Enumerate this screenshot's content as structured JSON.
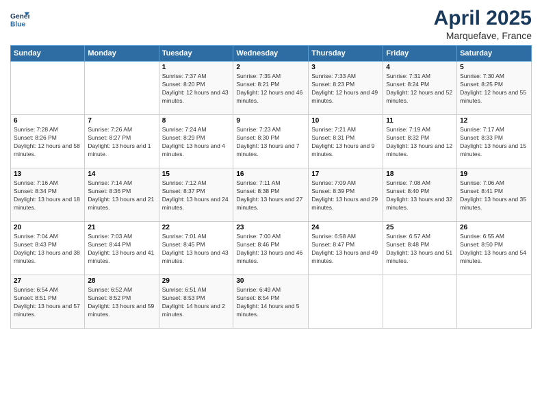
{
  "logo": {
    "line1": "General",
    "line2": "Blue"
  },
  "title": "April 2025",
  "subtitle": "Marquefave, France",
  "header": {
    "days": [
      "Sunday",
      "Monday",
      "Tuesday",
      "Wednesday",
      "Thursday",
      "Friday",
      "Saturday"
    ]
  },
  "weeks": [
    [
      {
        "day": "",
        "info": ""
      },
      {
        "day": "",
        "info": ""
      },
      {
        "day": "1",
        "info": "Sunrise: 7:37 AM\nSunset: 8:20 PM\nDaylight: 12 hours and 43 minutes."
      },
      {
        "day": "2",
        "info": "Sunrise: 7:35 AM\nSunset: 8:21 PM\nDaylight: 12 hours and 46 minutes."
      },
      {
        "day": "3",
        "info": "Sunrise: 7:33 AM\nSunset: 8:23 PM\nDaylight: 12 hours and 49 minutes."
      },
      {
        "day": "4",
        "info": "Sunrise: 7:31 AM\nSunset: 8:24 PM\nDaylight: 12 hours and 52 minutes."
      },
      {
        "day": "5",
        "info": "Sunrise: 7:30 AM\nSunset: 8:25 PM\nDaylight: 12 hours and 55 minutes."
      }
    ],
    [
      {
        "day": "6",
        "info": "Sunrise: 7:28 AM\nSunset: 8:26 PM\nDaylight: 12 hours and 58 minutes."
      },
      {
        "day": "7",
        "info": "Sunrise: 7:26 AM\nSunset: 8:27 PM\nDaylight: 13 hours and 1 minute."
      },
      {
        "day": "8",
        "info": "Sunrise: 7:24 AM\nSunset: 8:29 PM\nDaylight: 13 hours and 4 minutes."
      },
      {
        "day": "9",
        "info": "Sunrise: 7:23 AM\nSunset: 8:30 PM\nDaylight: 13 hours and 7 minutes."
      },
      {
        "day": "10",
        "info": "Sunrise: 7:21 AM\nSunset: 8:31 PM\nDaylight: 13 hours and 9 minutes."
      },
      {
        "day": "11",
        "info": "Sunrise: 7:19 AM\nSunset: 8:32 PM\nDaylight: 13 hours and 12 minutes."
      },
      {
        "day": "12",
        "info": "Sunrise: 7:17 AM\nSunset: 8:33 PM\nDaylight: 13 hours and 15 minutes."
      }
    ],
    [
      {
        "day": "13",
        "info": "Sunrise: 7:16 AM\nSunset: 8:34 PM\nDaylight: 13 hours and 18 minutes."
      },
      {
        "day": "14",
        "info": "Sunrise: 7:14 AM\nSunset: 8:36 PM\nDaylight: 13 hours and 21 minutes."
      },
      {
        "day": "15",
        "info": "Sunrise: 7:12 AM\nSunset: 8:37 PM\nDaylight: 13 hours and 24 minutes."
      },
      {
        "day": "16",
        "info": "Sunrise: 7:11 AM\nSunset: 8:38 PM\nDaylight: 13 hours and 27 minutes."
      },
      {
        "day": "17",
        "info": "Sunrise: 7:09 AM\nSunset: 8:39 PM\nDaylight: 13 hours and 29 minutes."
      },
      {
        "day": "18",
        "info": "Sunrise: 7:08 AM\nSunset: 8:40 PM\nDaylight: 13 hours and 32 minutes."
      },
      {
        "day": "19",
        "info": "Sunrise: 7:06 AM\nSunset: 8:41 PM\nDaylight: 13 hours and 35 minutes."
      }
    ],
    [
      {
        "day": "20",
        "info": "Sunrise: 7:04 AM\nSunset: 8:43 PM\nDaylight: 13 hours and 38 minutes."
      },
      {
        "day": "21",
        "info": "Sunrise: 7:03 AM\nSunset: 8:44 PM\nDaylight: 13 hours and 41 minutes."
      },
      {
        "day": "22",
        "info": "Sunrise: 7:01 AM\nSunset: 8:45 PM\nDaylight: 13 hours and 43 minutes."
      },
      {
        "day": "23",
        "info": "Sunrise: 7:00 AM\nSunset: 8:46 PM\nDaylight: 13 hours and 46 minutes."
      },
      {
        "day": "24",
        "info": "Sunrise: 6:58 AM\nSunset: 8:47 PM\nDaylight: 13 hours and 49 minutes."
      },
      {
        "day": "25",
        "info": "Sunrise: 6:57 AM\nSunset: 8:48 PM\nDaylight: 13 hours and 51 minutes."
      },
      {
        "day": "26",
        "info": "Sunrise: 6:55 AM\nSunset: 8:50 PM\nDaylight: 13 hours and 54 minutes."
      }
    ],
    [
      {
        "day": "27",
        "info": "Sunrise: 6:54 AM\nSunset: 8:51 PM\nDaylight: 13 hours and 57 minutes."
      },
      {
        "day": "28",
        "info": "Sunrise: 6:52 AM\nSunset: 8:52 PM\nDaylight: 13 hours and 59 minutes."
      },
      {
        "day": "29",
        "info": "Sunrise: 6:51 AM\nSunset: 8:53 PM\nDaylight: 14 hours and 2 minutes."
      },
      {
        "day": "30",
        "info": "Sunrise: 6:49 AM\nSunset: 8:54 PM\nDaylight: 14 hours and 5 minutes."
      },
      {
        "day": "",
        "info": ""
      },
      {
        "day": "",
        "info": ""
      },
      {
        "day": "",
        "info": ""
      }
    ]
  ]
}
